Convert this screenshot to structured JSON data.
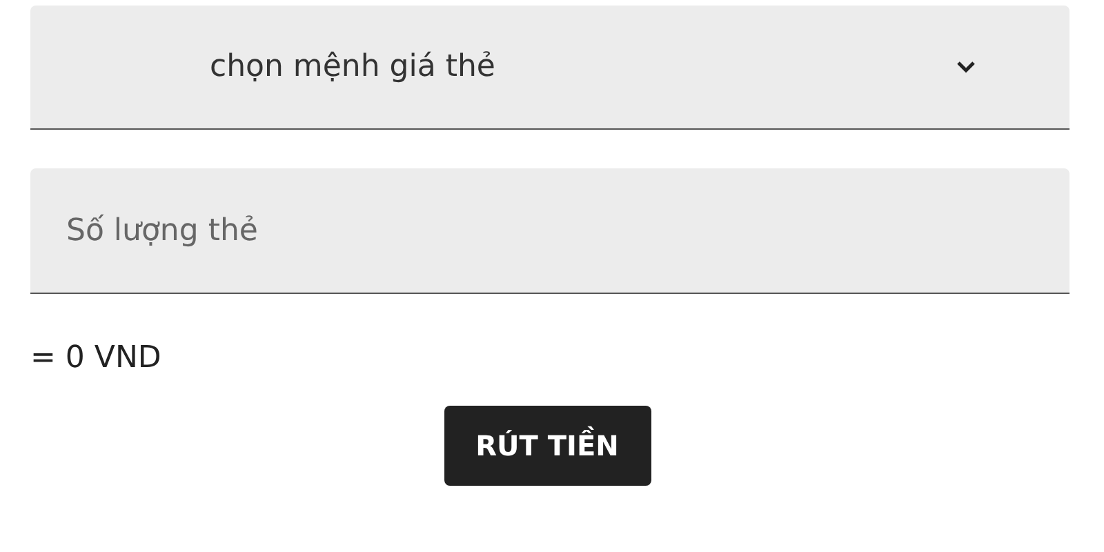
{
  "denomination_select": {
    "value": "chọn mệnh giá thẻ"
  },
  "quantity_field": {
    "placeholder": "Số lượng thẻ"
  },
  "total": "= 0 VND",
  "withdraw_button": "RÚT TIỀN"
}
